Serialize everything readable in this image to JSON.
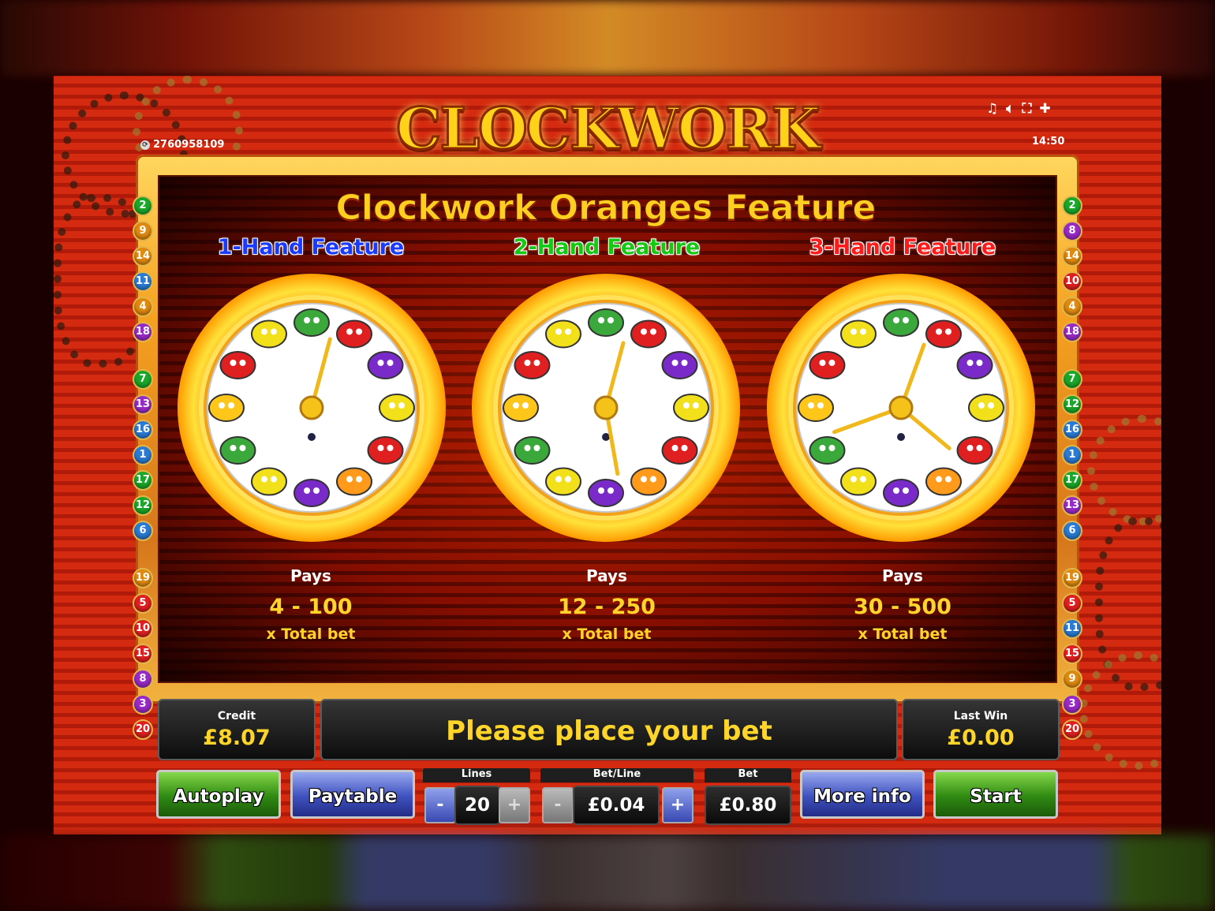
{
  "header": {
    "title": "CLOCKWORK ORANGES",
    "ticket_id": "2760958109",
    "time": "14:50",
    "icons": [
      "music-icon",
      "sound-icon",
      "fullscreen-icon",
      "settings-icon"
    ]
  },
  "feature": {
    "title": "Clockwork Oranges Feature",
    "columns": [
      {
        "label": "1-Hand Feature",
        "pays_label": "Pays",
        "range": "4 - 100",
        "unit": "x Total bet",
        "color": "#1a3aff"
      },
      {
        "label": "2-Hand Feature",
        "pays_label": "Pays",
        "range": "12 - 250",
        "unit": "x Total bet",
        "color": "#14c814"
      },
      {
        "label": "3-Hand Feature",
        "pays_label": "Pays",
        "range": "30 - 500",
        "unit": "x Total bet",
        "color": "#ff1a1a"
      }
    ]
  },
  "paylines": {
    "left": [
      "2",
      "9",
      "14",
      "11",
      "4",
      "18",
      "7",
      "13",
      "16",
      "1",
      "17",
      "12",
      "6",
      "19",
      "5",
      "10",
      "15",
      "8",
      "3",
      "20"
    ],
    "right": [
      "2",
      "8",
      "14",
      "10",
      "4",
      "18",
      "7",
      "12",
      "16",
      "1",
      "17",
      "13",
      "6",
      "19",
      "5",
      "11",
      "15",
      "9",
      "3",
      "20"
    ]
  },
  "status": {
    "credit_label": "Credit",
    "credit_value": "£8.07",
    "message": "Please place your bet",
    "last_win_label": "Last Win",
    "last_win_value": "£0.00"
  },
  "controls": {
    "autoplay": "Autoplay",
    "paytable": "Paytable",
    "lines_label": "Lines",
    "lines_value": "20",
    "bet_line_label": "Bet/Line",
    "bet_line_value": "£0.04",
    "bet_label": "Bet",
    "bet_value": "£0.80",
    "more_info": "More info",
    "start": "Start",
    "minus": "-",
    "plus": "+"
  }
}
